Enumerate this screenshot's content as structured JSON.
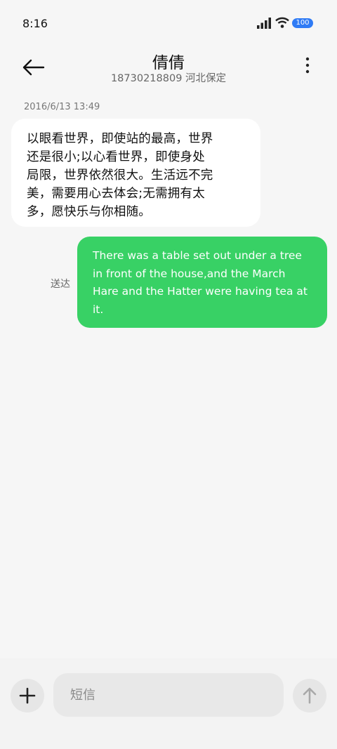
{
  "status_bar": {
    "time": "8:16",
    "battery": "100",
    "icons": [
      "signal-icon",
      "wifi-icon",
      "battery-icon"
    ],
    "battery_color": "#2f7bf5"
  },
  "header": {
    "contact_name": "倩倩",
    "contact_subtitle": "18730218809 河北保定",
    "back_icon": "back-arrow-icon",
    "more_icon": "more-vertical-icon"
  },
  "conversation": {
    "timestamp": "2016/6/13 13:49",
    "incoming": {
      "lines": [
        "以眼看世界，即使站的最高，世界",
        "还是很小;以心看世界，即使身处",
        "局限，世界依然很大。生活远不完",
        "美，需要用心去体会;无需拥有太",
        "多，愿快乐与你相随。"
      ]
    },
    "outgoing": {
      "status": "送达",
      "lines": [
        "There was a table set out under a tree",
        "in front of the house,and the March",
        "Hare and the Hatter were having tea at",
        "it."
      ],
      "color": "#38d165"
    }
  },
  "compose": {
    "placeholder": "短信",
    "add_icon": "plus-icon",
    "send_icon": "send-arrow-up-icon"
  }
}
